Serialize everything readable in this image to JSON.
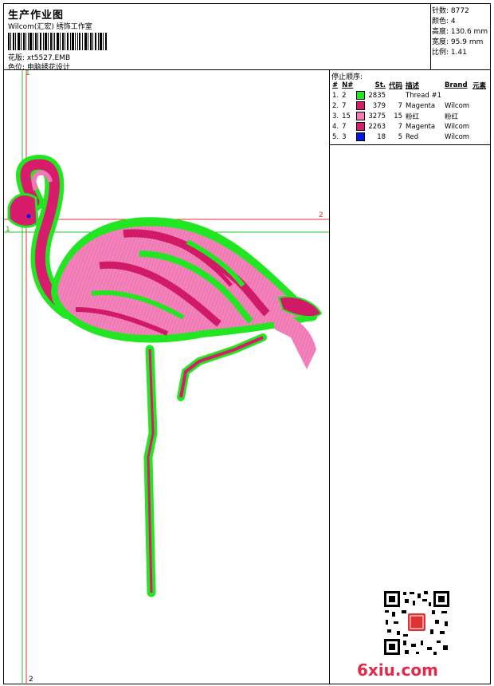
{
  "header": {
    "title": "生产作业图",
    "subtitle": "Wilcom(汇宏) 绣饰工作室",
    "design_label": "花版:",
    "design_value": "xt5527.EMB",
    "colorpos_label": "色位:",
    "colorpos_value": "电脑绣花设计"
  },
  "stats": [
    {
      "label": "针数:",
      "value": "8772"
    },
    {
      "label": "颜色:",
      "value": "4"
    },
    {
      "label": "高度:",
      "value": "130.6 mm"
    },
    {
      "label": "宽度:",
      "value": "95.9 mm"
    },
    {
      "label": "比例:",
      "value": "1.41"
    }
  ],
  "stop_sequence": {
    "title": "停止顺序:",
    "headers": {
      "idx": "#",
      "n": "N#",
      "st": "St.",
      "code": "代码",
      "desc": "描述",
      "brand": "Brand",
      "elem": "元素"
    },
    "rows": [
      {
        "idx": "1.",
        "n": "2",
        "color": "#22e622",
        "st": "2835",
        "code": "",
        "desc": "Thread #1",
        "brand": ""
      },
      {
        "idx": "2.",
        "n": "7",
        "color": "#d81b6a",
        "st": "379",
        "code": "7",
        "desc": "Magenta",
        "brand": "Wilcom"
      },
      {
        "idx": "3.",
        "n": "15",
        "color": "#f279b5",
        "st": "3275",
        "code": "15",
        "desc": "粉红",
        "brand": "粉红"
      },
      {
        "idx": "4.",
        "n": "7",
        "color": "#d81b6a",
        "st": "2263",
        "code": "7",
        "desc": "Magenta",
        "brand": "Wilcom"
      },
      {
        "idx": "5.",
        "n": "3",
        "color": "#0018e6",
        "st": "18",
        "code": "5",
        "desc": "Red",
        "brand": "Wilcom"
      }
    ]
  },
  "guides": {
    "top_left": "1",
    "right_mark": "2",
    "left_mark": "1",
    "bottom_mark": "2"
  },
  "watermark": "6xiu.com",
  "colors": {
    "green": "#22e622",
    "magenta": "#d81b6a",
    "pink": "#f279b5",
    "red": "#e0303a"
  }
}
